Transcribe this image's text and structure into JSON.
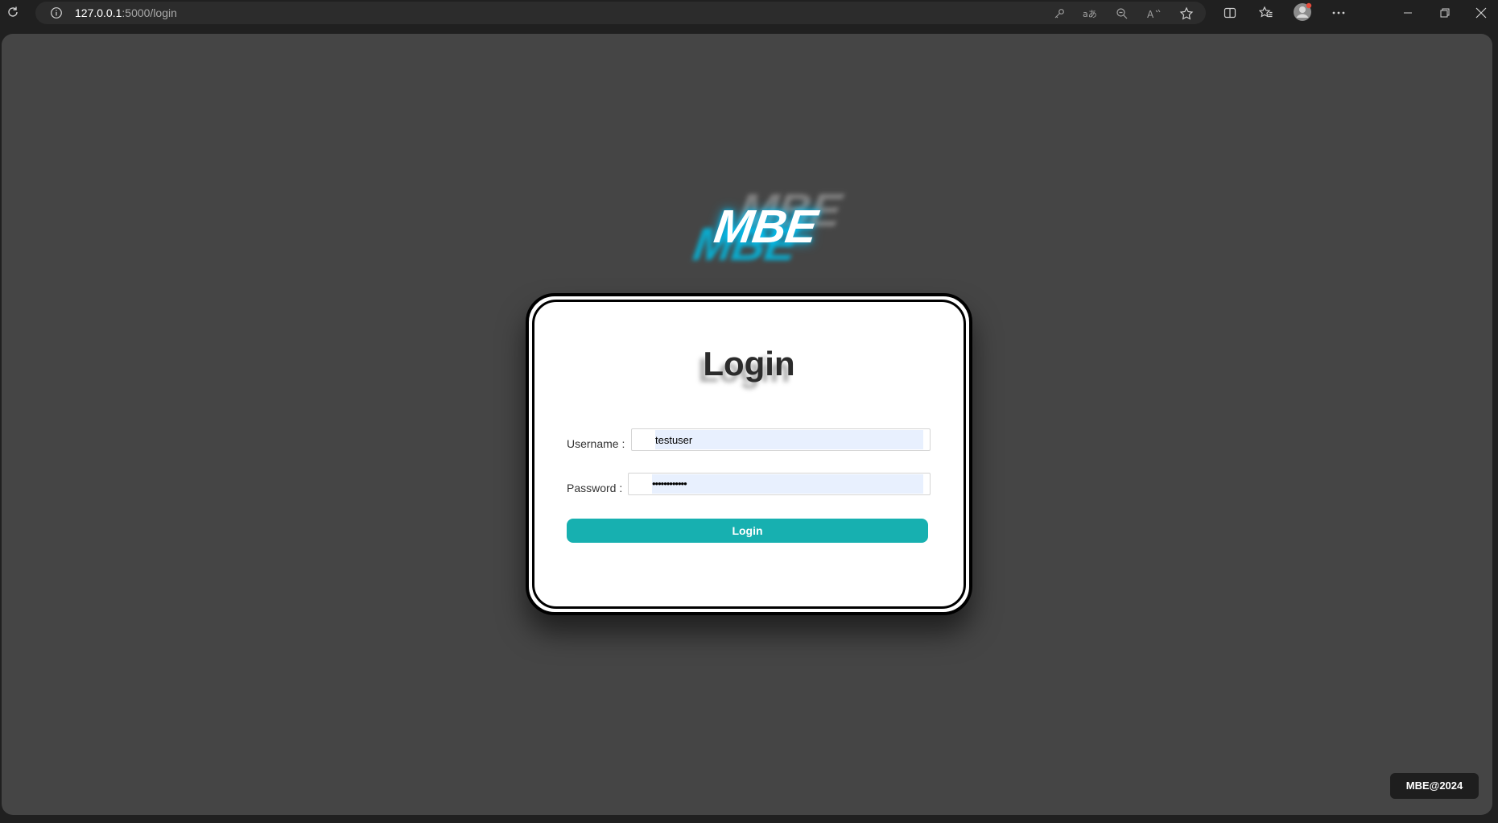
{
  "browser": {
    "url_host": "127.0.0.1",
    "url_path": ":5000/login",
    "icons": [
      "reload-icon",
      "info-icon",
      "key-icon",
      "translate-icon",
      "zoom-out-icon",
      "read-aloud-icon",
      "favorite-star-icon",
      "split-screen-icon",
      "favorites-icon",
      "profile-icon",
      "more-icon",
      "minimize-icon",
      "restore-icon",
      "close-icon"
    ]
  },
  "logo": {
    "text": "MBE"
  },
  "login": {
    "title": "Login",
    "username_label": "Username :",
    "username_value": "testuser",
    "password_label": "Password :",
    "password_value": "••••••••••••",
    "button_label": "Login"
  },
  "footer": {
    "badge": "MBE@2024"
  },
  "colors": {
    "page_background": "#454545",
    "button": "#17b0b0",
    "autofill": "#e8f0fe",
    "logo_glow": "#00c8ff"
  }
}
